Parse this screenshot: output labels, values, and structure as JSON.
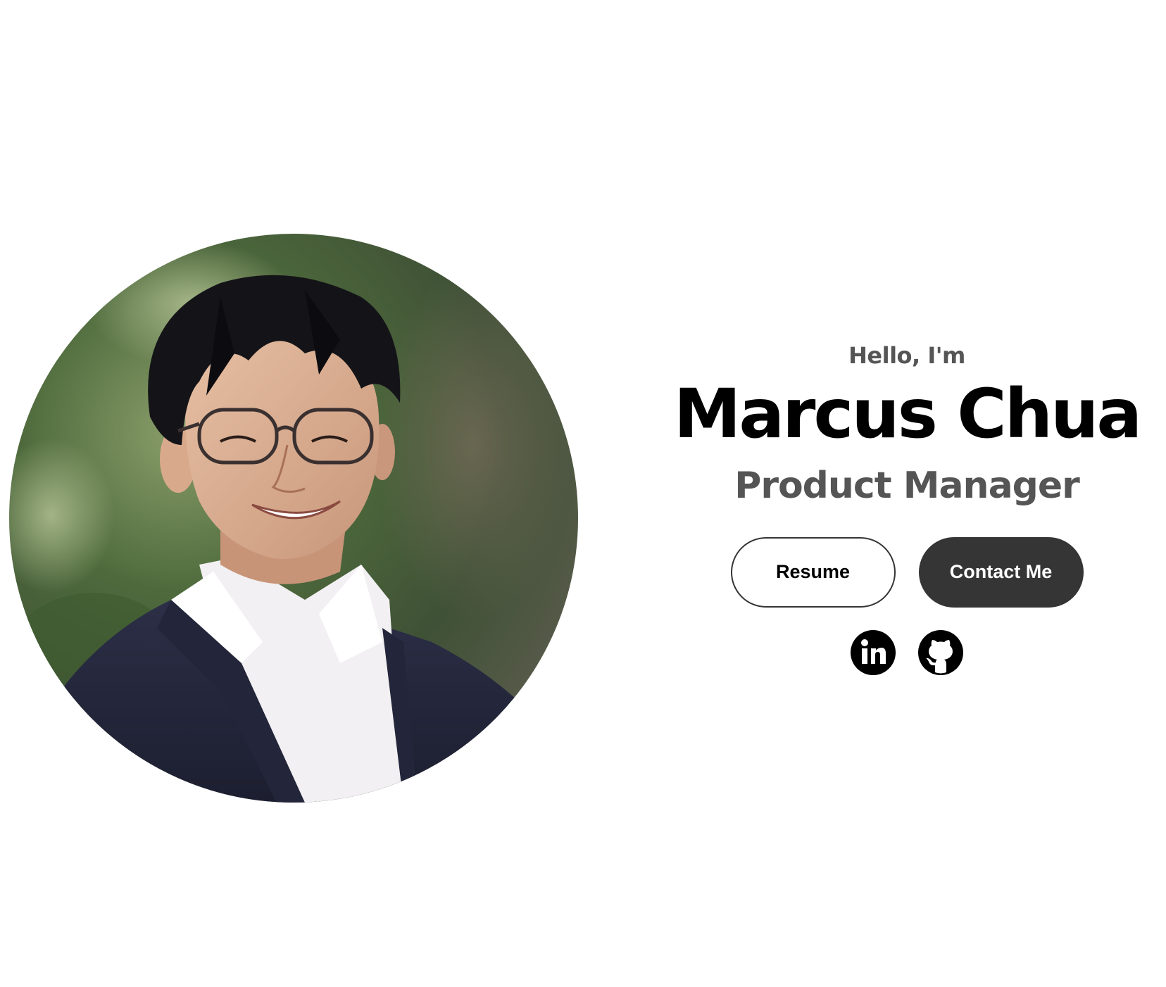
{
  "profile": {
    "photo_alt": "Marcus Chua profile picture"
  },
  "intro": {
    "greeting": "Hello, I'm",
    "name": "Marcus Chua",
    "role": "Product Manager"
  },
  "buttons": {
    "resume_label": "Resume",
    "contact_label": "Contact Me"
  },
  "socials": [
    {
      "icon": "linkedin-icon",
      "label": "LinkedIn"
    },
    {
      "icon": "github-icon",
      "label": "GitHub"
    }
  ],
  "colors": {
    "text_primary": "#000000",
    "text_secondary": "#555555",
    "button_dark": "#353535",
    "background": "#ffffff"
  }
}
